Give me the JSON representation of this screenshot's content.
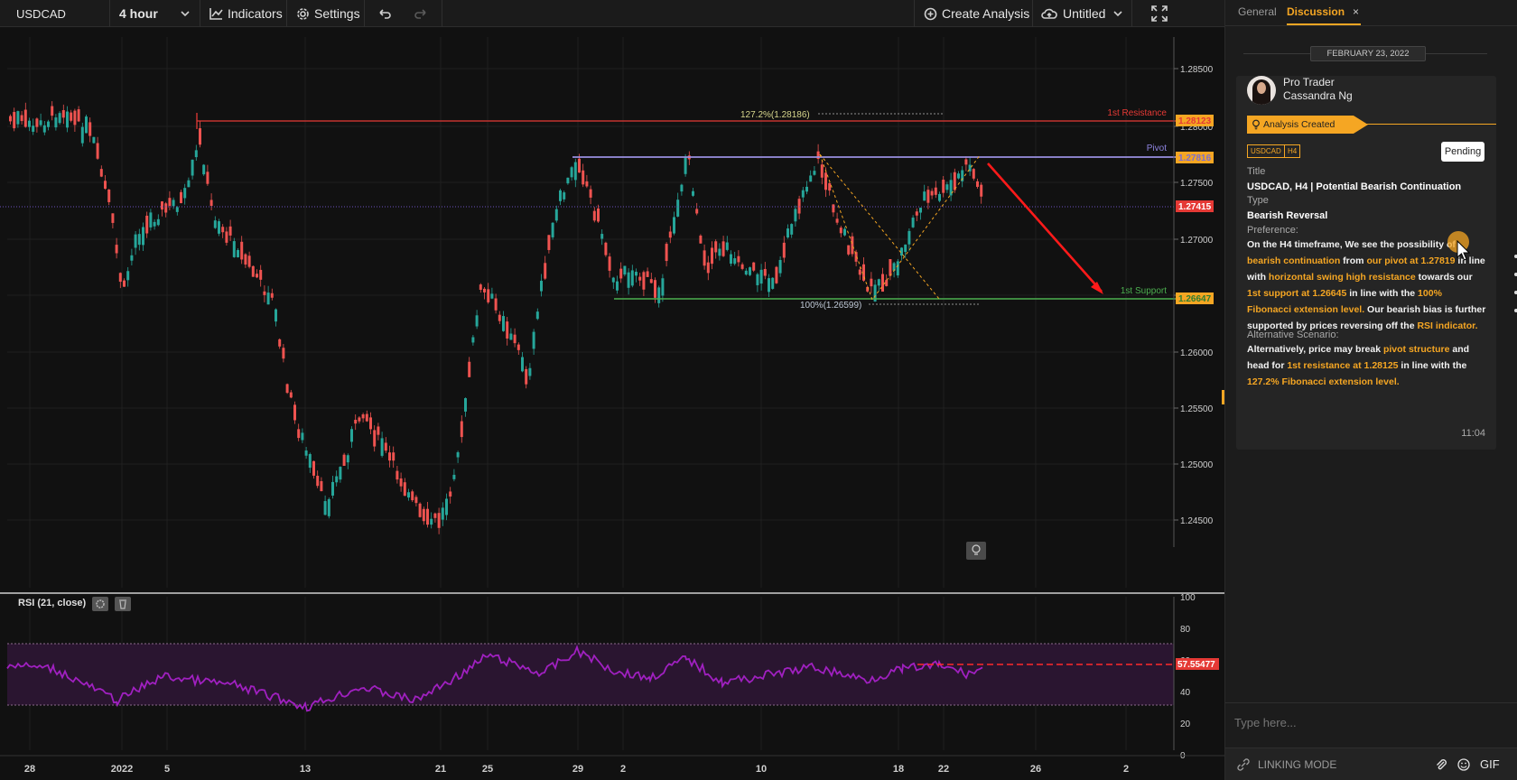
{
  "toolbar": {
    "symbol": "USDCAD",
    "timeframe": "4 hour",
    "indicators": "Indicators",
    "settings": "Settings",
    "create_analysis": "Create Analysis",
    "layout_name": "Untitled"
  },
  "chart": {
    "price_axis": [
      "1.28500",
      "1.28000",
      "1.27500",
      "1.27000",
      "1.26500",
      "1.26000",
      "1.25500",
      "1.25000",
      "1.24500"
    ],
    "date_axis": [
      "28",
      "2022",
      "5",
      "13",
      "21",
      "25",
      "29",
      "2",
      "10",
      "18",
      "22",
      "26",
      "2"
    ],
    "levels": {
      "resistance": {
        "label": "1st Resistance",
        "price": "1.28123"
      },
      "pivot": {
        "label": "Pivot",
        "price": "1.27816"
      },
      "current": {
        "price": "1.27415"
      },
      "support": {
        "label": "1st Support",
        "price": "1.26647"
      }
    },
    "fib_upper": "127.2%(1.28186)",
    "fib_lower": "100%(1.26599)",
    "colors": {
      "resistance": "#e53935",
      "pivot": "#9a8fe0",
      "support": "#4caf50",
      "bull": "#26a69a",
      "bear": "#ef5350",
      "accent": "#f5a623",
      "rsi": "#a020c0"
    }
  },
  "rsi": {
    "title": "RSI (21, close)",
    "axis": [
      "100",
      "80",
      "60",
      "40",
      "20",
      "0"
    ],
    "value": "57.55477",
    "gear_icon": "gear-icon",
    "trash_icon": "trash-icon"
  },
  "panel": {
    "tabs": {
      "general": "General",
      "discussion": "Discussion"
    },
    "date": "FEBRUARY 23, 2022",
    "author_role": "Pro Trader",
    "author_name": "Cassandra Ng",
    "ribbon": "Analysis Created",
    "tag_symbol": "USDCAD",
    "tag_tf": "H4",
    "status": "Pending",
    "title_label": "Title",
    "title_value": "USDCAD, H4 | Potential Bearish Continuation",
    "type_label": "Type",
    "type_value": "Bearish Reversal",
    "pref_label": "Preference:",
    "pref": [
      {
        "t": "On the H4 timeframe, We see the possibility of ",
        "h": false
      },
      {
        "t": "bearish continuation",
        "h": true
      },
      {
        "t": " from ",
        "h": false
      },
      {
        "t": "our pivot at 1.27819",
        "h": true
      },
      {
        "t": " in line with ",
        "h": false
      },
      {
        "t": "horizontal swing high resistance",
        "h": true
      },
      {
        "t": " towards our ",
        "h": false
      },
      {
        "t": "1st support at 1.26645",
        "h": true
      },
      {
        "t": " in line with the ",
        "h": false
      },
      {
        "t": "100% Fibonacci extension level.",
        "h": true
      },
      {
        "t": " Our bearish bias is further supported by prices reversing off the ",
        "h": false
      },
      {
        "t": "RSI indicator.",
        "h": true
      }
    ],
    "alt_label": "Alternative Scenario:",
    "alt": [
      {
        "t": "Alternatively, price may break ",
        "h": false
      },
      {
        "t": "pivot structure",
        "h": true
      },
      {
        "t": " and head for ",
        "h": false
      },
      {
        "t": "1st resistance at 1.28125",
        "h": true
      },
      {
        "t": " in line with the ",
        "h": false
      },
      {
        "t": "127.2% Fibonacci extension level.",
        "h": true
      }
    ],
    "time": "11:04",
    "input_placeholder": "Type here...",
    "linking_mode": "LINKING MODE",
    "gif": "GIF"
  }
}
